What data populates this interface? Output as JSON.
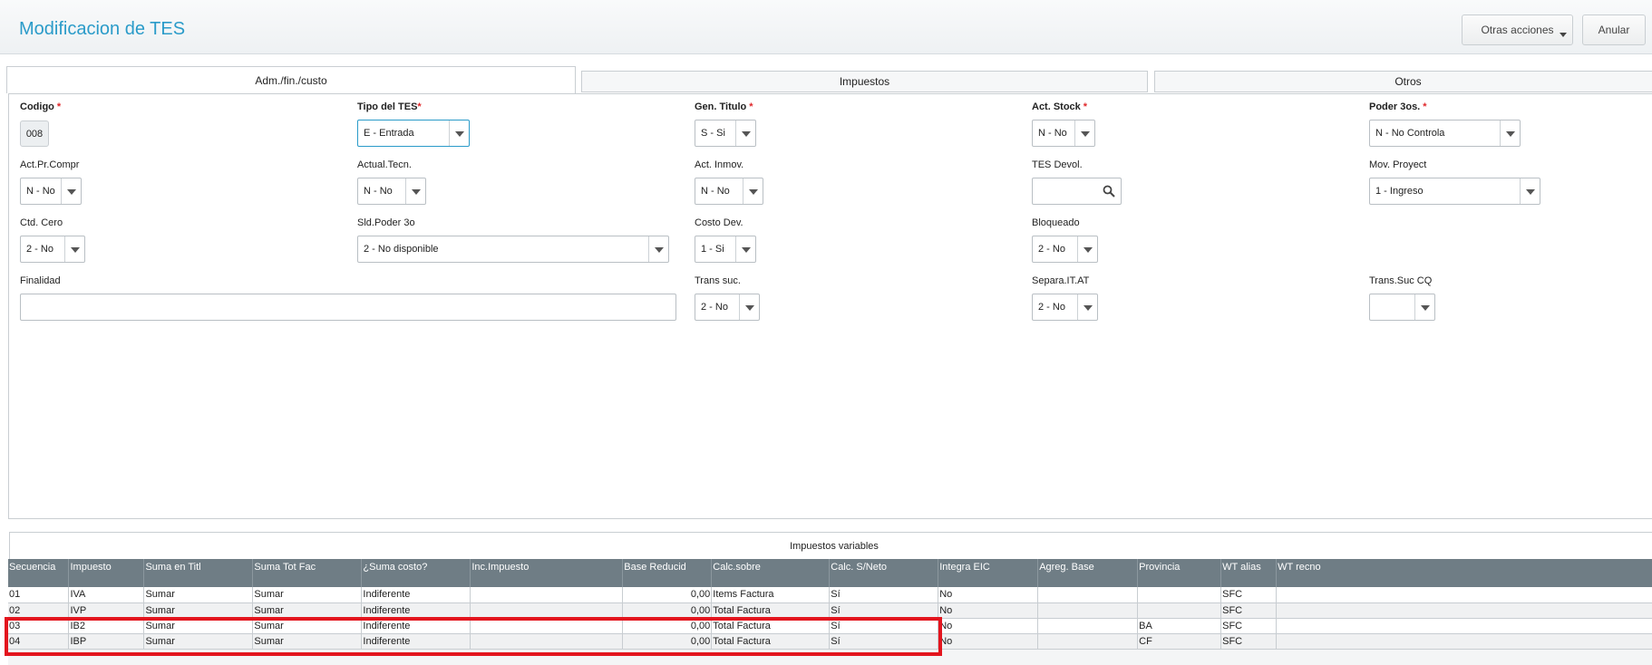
{
  "header": {
    "title": "Modificacion de TES",
    "actions": {
      "more_label": "Otras acciones",
      "cancel_label": "Anular"
    }
  },
  "tabs": [
    {
      "label": "Adm./fin./custo",
      "active": true
    },
    {
      "label": "Impuestos",
      "active": false
    },
    {
      "label": "Otros",
      "active": false
    }
  ],
  "form": {
    "codigo": {
      "label": "Codigo",
      "value": "008"
    },
    "tipo_tes": {
      "label": "Tipo del TES",
      "value": "E - Entrada"
    },
    "gen_titulo": {
      "label": "Gen. Titulo",
      "value": "S - Si"
    },
    "act_stock": {
      "label": "Act. Stock",
      "value": "N - No"
    },
    "poder_3os": {
      "label": "Poder 3os.",
      "value": "N - No Controla"
    },
    "act_pr_compr": {
      "label": "Act.Pr.Compr",
      "value": "N - No"
    },
    "actual_tecn": {
      "label": "Actual.Tecn.",
      "value": "N - No"
    },
    "act_inmov": {
      "label": "Act. Inmov.",
      "value": "N - No"
    },
    "tes_devol": {
      "label": "TES Devol.",
      "value": ""
    },
    "mov_proyect": {
      "label": "Mov. Proyect",
      "value": "1 - Ingreso"
    },
    "ctd_cero": {
      "label": "Ctd. Cero",
      "value": "2 - No"
    },
    "sld_poder_3o": {
      "label": "Sld.Poder 3o",
      "value": "2 - No disponible"
    },
    "costo_dev": {
      "label": "Costo Dev.",
      "value": "1 - Si"
    },
    "bloqueado": {
      "label": "Bloqueado",
      "value": "2 - No"
    },
    "finalidad": {
      "label": "Finalidad",
      "value": ""
    },
    "trans_suc": {
      "label": "Trans suc.",
      "value": "2 - No"
    },
    "separa_it_at": {
      "label": "Separa.IT.AT",
      "value": "2 - No"
    },
    "trans_suc_cq": {
      "label": "Trans.Suc CQ",
      "value": ""
    }
  },
  "grid": {
    "title": "Impuestos variables",
    "columns": [
      "Secuencia",
      "Impuesto",
      "Suma en Titl",
      "Suma Tot Fac",
      "¿Suma costo?",
      "Inc.Impuesto",
      "Base Reducid",
      "Calc.sobre",
      "Calc. S/Neto",
      "Integra EIC",
      "Agreg. Base",
      "Provincia",
      "WT alias",
      "WT recno"
    ],
    "rows": [
      [
        "01",
        "IVA",
        "Sumar",
        "Sumar",
        "Indiferente",
        "",
        "0,00",
        "Items Factura",
        "Sí",
        "No",
        "",
        "",
        "SFC",
        ""
      ],
      [
        "02",
        "IVP",
        "Sumar",
        "Sumar",
        "Indiferente",
        "",
        "0,00",
        "Total Factura",
        "Sí",
        "No",
        "",
        "",
        "SFC",
        ""
      ],
      [
        "03",
        "IB2",
        "Sumar",
        "Sumar",
        "Indiferente",
        "",
        "0,00",
        "Total Factura",
        "Sí",
        "No",
        "",
        "BA",
        "SFC",
        ""
      ],
      [
        "04",
        "IBP",
        "Sumar",
        "Sumar",
        "Indiferente",
        "",
        "0,00",
        "Total Factura",
        "Sí",
        "No",
        "",
        "CF",
        "SFC",
        ""
      ]
    ]
  },
  "colors": {
    "title": "#2a9bc9",
    "required": "#e0282b",
    "grid_header": "#6f7d85",
    "highlight": "#e3151e"
  }
}
